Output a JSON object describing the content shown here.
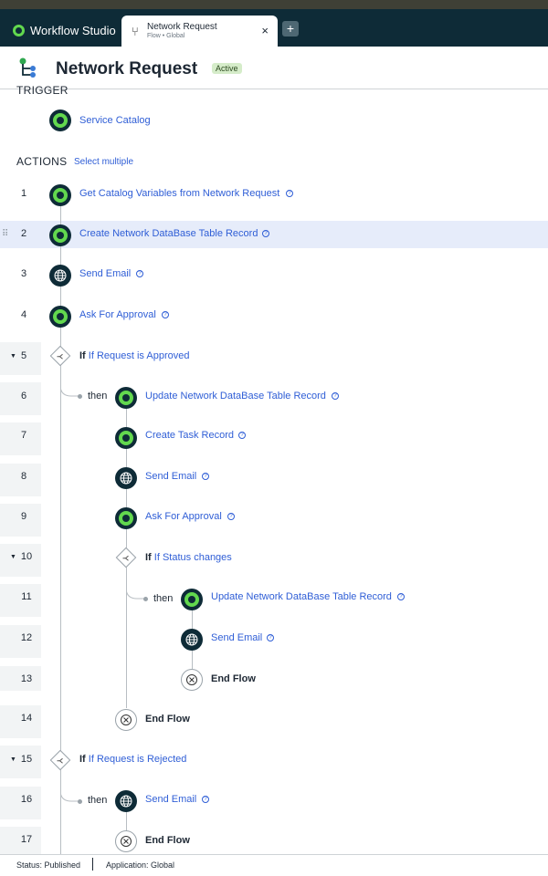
{
  "app": {
    "name": "Workflow Studio"
  },
  "tab": {
    "title": "Network Request",
    "subtitle": "Flow • Global",
    "close": "×",
    "new_tab": "+"
  },
  "header": {
    "title": "Network Request",
    "badge": "Active"
  },
  "trigger": {
    "heading": "TRIGGER",
    "name": "Service Catalog"
  },
  "actions": {
    "heading": "ACTIONS",
    "select_multiple": "Select multiple",
    "then_label": "then",
    "if_label": "If",
    "end_flow": "End Flow",
    "steps": [
      {
        "num": "1",
        "label": "Get Catalog Variables from Network Request",
        "kind": "action",
        "icon": "green-circle-icon"
      },
      {
        "num": "2",
        "label": "Create Network DataBase Table Record",
        "kind": "action",
        "icon": "green-circle-icon",
        "selected": true
      },
      {
        "num": "3",
        "label": "Send Email",
        "kind": "action",
        "icon": "globe-icon"
      },
      {
        "num": "4",
        "label": "Ask For Approval",
        "kind": "action",
        "icon": "green-circle-icon"
      },
      {
        "num": "5",
        "label": "If Request is Approved",
        "kind": "if"
      },
      {
        "num": "6",
        "label": "Update Network DataBase Table Record",
        "kind": "action",
        "icon": "green-circle-icon"
      },
      {
        "num": "7",
        "label": "Create Task Record",
        "kind": "action",
        "icon": "green-circle-icon"
      },
      {
        "num": "8",
        "label": "Send Email",
        "kind": "action",
        "icon": "globe-icon"
      },
      {
        "num": "9",
        "label": "Ask For Approval",
        "kind": "action",
        "icon": "green-circle-icon"
      },
      {
        "num": "10",
        "label": "If Status changes",
        "kind": "if"
      },
      {
        "num": "11",
        "label": "Update Network DataBase Table Record",
        "kind": "action",
        "icon": "green-circle-icon"
      },
      {
        "num": "12",
        "label": "Send Email",
        "kind": "action",
        "icon": "globe-icon"
      },
      {
        "num": "13",
        "label": "End Flow",
        "kind": "end"
      },
      {
        "num": "14",
        "label": "End Flow",
        "kind": "end"
      },
      {
        "num": "15",
        "label": "If Request is Rejected",
        "kind": "if"
      },
      {
        "num": "16",
        "label": "Send Email",
        "kind": "action",
        "icon": "globe-icon"
      },
      {
        "num": "17",
        "label": "End Flow",
        "kind": "end"
      }
    ]
  },
  "footer": {
    "status": "Status: Published",
    "application": "Application: Global"
  },
  "colors": {
    "topbar": "#0e2b37",
    "accent_green": "#62d84e",
    "link_blue": "#2f5ed6",
    "selected_row": "#e6ecfa"
  }
}
